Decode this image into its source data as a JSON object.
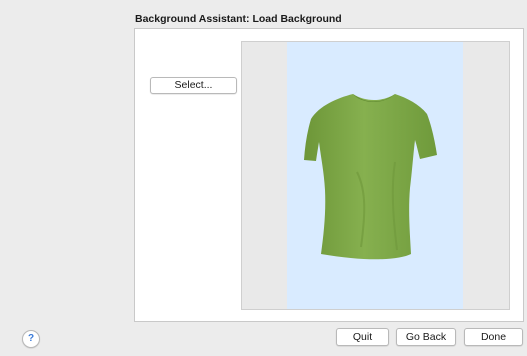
{
  "dialog": {
    "title": "Background Assistant: Load Background"
  },
  "content": {
    "select_button_label": "Select...",
    "preview_background_color": "#d9ebff",
    "garment_color": "#7fa84a"
  },
  "footer": {
    "help_label": "?",
    "quit_label": "Quit",
    "go_back_label": "Go Back",
    "done_label": "Done"
  }
}
